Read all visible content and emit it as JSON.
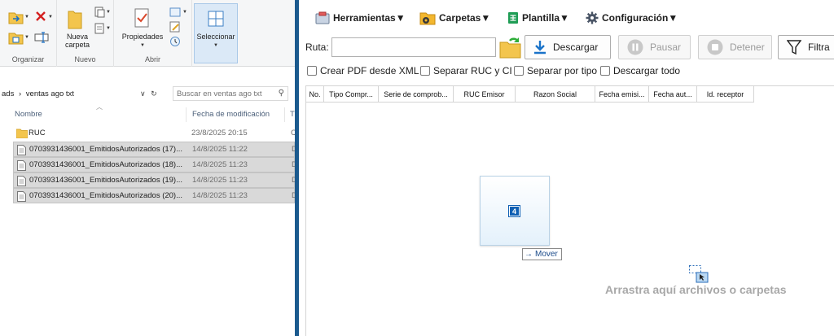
{
  "explorer": {
    "ribbon": {
      "groups": {
        "organizar": "Organizar",
        "nuevo": "Nuevo",
        "abrir": "Abrir"
      },
      "nueva_carpeta": [
        "Nueva",
        "carpeta"
      ],
      "propiedades": "Propiedades",
      "seleccionar": "Seleccionar"
    },
    "address": {
      "path_tail": "ads",
      "separator": "›",
      "current_folder": "ventas ago txt",
      "chevron": "∨",
      "refresh": "↻"
    },
    "search": {
      "placeholder": "Buscar en ventas ago txt"
    },
    "columns": {
      "name": "Nombre",
      "modified": "Fecha de modificación",
      "type": "Ti"
    },
    "files": [
      {
        "name": "RUC",
        "date": "23/8/2025 20:15",
        "type": "C",
        "kind": "folder",
        "selected": false
      },
      {
        "name": "0703931436001_EmitidosAutorizados (17)...",
        "date": "14/8/2025 11:22",
        "type": "D",
        "kind": "file",
        "selected": true
      },
      {
        "name": "0703931436001_EmitidosAutorizados (18)...",
        "date": "14/8/2025 11:23",
        "type": "D",
        "kind": "file",
        "selected": true
      },
      {
        "name": "0703931436001_EmitidosAutorizados (19)...",
        "date": "14/8/2025 11:23",
        "type": "D",
        "kind": "file",
        "selected": true
      },
      {
        "name": "0703931436001_EmitidosAutorizados (20)...",
        "date": "14/8/2025 11:23",
        "type": "D",
        "kind": "file",
        "selected": true
      }
    ]
  },
  "app": {
    "menu": {
      "herramientas": "Herramientas▼",
      "carpetas": "Carpetas▼",
      "plantilla": "Plantilla▼",
      "configuracion": "Configuración▼"
    },
    "ruta_label": "Ruta:",
    "ruta_value": "",
    "buttons": {
      "descargar": "Descargar",
      "pausar": "Pausar",
      "detener": "Detener",
      "filtrar": "Filtra"
    },
    "checkboxes": {
      "crear_pdf": "Crear PDF desde XML",
      "separar_ruc": "Separar RUC y CI",
      "separar_tipo": "Separar por tipo",
      "descargar_todo": "Descargar todo"
    },
    "grid_columns": [
      "No.",
      "Tipo Compr...",
      "Serie de comprob...",
      "RUC Emisor",
      "Razon Social",
      "Fecha emisi...",
      "Fecha aut...",
      "Id. receptor"
    ],
    "drag": {
      "count": "4",
      "tip_arrow": "→",
      "tip": "Mover"
    },
    "drop_hint": "Arrastra aquí archivos o carpetas"
  },
  "colors": {
    "accent": "#0e5fb3",
    "divider": "#1b5a8e",
    "selection": "#d9d9d9",
    "drop_hint": "#a8a8a8"
  }
}
